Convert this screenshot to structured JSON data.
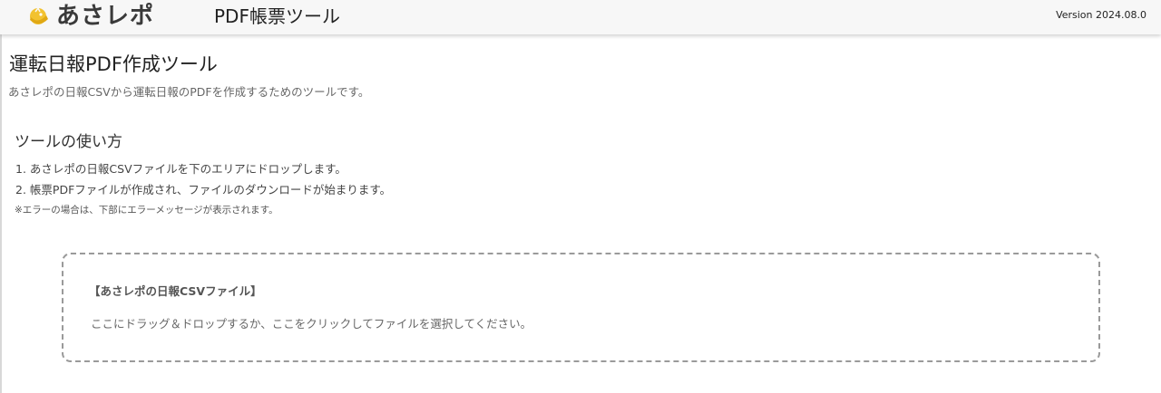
{
  "header": {
    "logo_text": "あさレポ",
    "logo_icon": "sun-logo-icon",
    "app_name": "PDF帳票ツール",
    "version": "Version 2024.08.0"
  },
  "colors": {
    "header_bg": "#f7f7f7",
    "logo_accent": "#f2c230",
    "text_primary": "#222222",
    "text_muted": "#666666",
    "dropzone_border": "#9a9a9a"
  },
  "main": {
    "title": "運転日報PDF作成ツール",
    "description": "あさレポの日報CSVから運転日報のPDFを作成するためのツールです。"
  },
  "howto": {
    "heading": "ツールの使い方",
    "steps": [
      "1. あさレポの日報CSVファイルを下のエリアにドロップします。",
      "2. 帳票PDFファイルが作成され、ファイルのダウンロードが始まります。"
    ],
    "note": "※エラーの場合は、下部にエラーメッセージが表示されます。"
  },
  "dropzone": {
    "title": "【あさレポの日報CSVファイル】",
    "instruction": "ここにドラッグ＆ドロップするか、ここをクリックしてファイルを選択してください。"
  }
}
